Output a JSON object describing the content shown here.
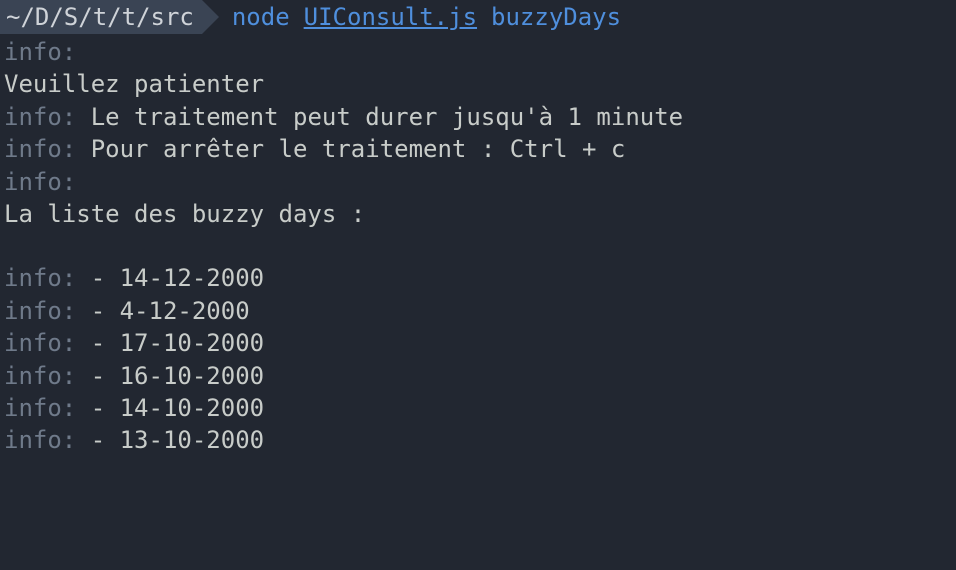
{
  "prompt": {
    "path": "~/D/S/t/t/src",
    "command": "node",
    "file": "UIConsult.js",
    "arg": "buzzyDays"
  },
  "labels": {
    "info": "info"
  },
  "messages": {
    "wait": "Veuillez patienter",
    "duration": "Le traitement peut durer jusqu'à 1 minute",
    "stop": "Pour arrêter le traitement : Ctrl + c",
    "list_header": "La liste des buzzy days :"
  },
  "dates": [
    "14-12-2000",
    "4-12-2000",
    "17-10-2000",
    "16-10-2000",
    "14-10-2000",
    "13-10-2000"
  ]
}
